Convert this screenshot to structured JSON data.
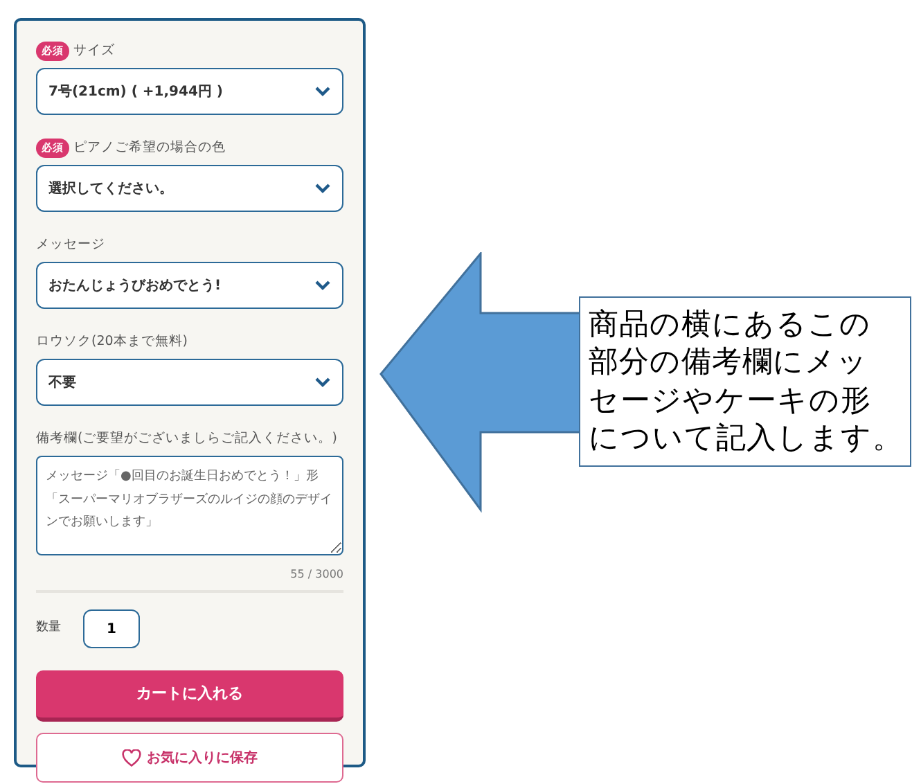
{
  "form": {
    "fields": [
      {
        "kind": "select",
        "label": "サイズ",
        "required": true,
        "required_badge": "必須",
        "value": "7号(21cm) ( +1,944円 )"
      },
      {
        "kind": "select",
        "label": "ピアノご希望の場合の色",
        "required": true,
        "required_badge": "必須",
        "value": "選択してください。"
      },
      {
        "kind": "select",
        "label": "メッセージ",
        "required": false,
        "value": "おたんじょうびおめでとう!"
      },
      {
        "kind": "select",
        "label": "ロウソク(20本まで無料)",
        "required": false,
        "value": "不要"
      },
      {
        "kind": "textarea",
        "label": "備考欄(ご要望がございましらご記入ください。)",
        "required": false,
        "value": "メッセージ「●回目のお誕生日おめでとう！」形「スーパーマリオブラザーズのルイジの顔のデザインでお願いします」",
        "counter": "55 / 3000"
      }
    ],
    "quantity": {
      "label": "数量",
      "value": "1"
    },
    "buttons": [
      {
        "kind": "primary",
        "label": "カートに入れる"
      },
      {
        "kind": "outline",
        "label": "お気に入りに保存"
      }
    ]
  },
  "callout": {
    "lines": [
      "商品の横にあるこの",
      "部分の備考欄にメッ",
      "セージやケーキの形",
      "について記入します。"
    ]
  }
}
